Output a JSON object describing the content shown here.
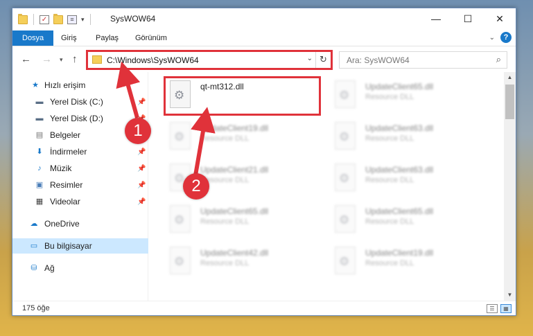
{
  "window": {
    "title": "SysWOW64",
    "controls": {
      "minimize": "—",
      "maximize": "☐",
      "close": "✕"
    }
  },
  "ribbon": {
    "tabs": [
      "Dosya",
      "Giriş",
      "Paylaş",
      "Görünüm"
    ],
    "help": "?"
  },
  "navigation": {
    "address": "C:\\Windows\\SysWOW64",
    "search_placeholder": "Ara: SysWOW64"
  },
  "sidebar": {
    "items": [
      {
        "label": "Hızlı erişim",
        "icon": "star-icon",
        "pinned": false
      },
      {
        "label": "Yerel Disk (C:)",
        "icon": "drive-icon",
        "pinned": true
      },
      {
        "label": "Yerel Disk (D:)",
        "icon": "drive-icon",
        "pinned": true
      },
      {
        "label": "Belgeler",
        "icon": "document-icon",
        "pinned": true
      },
      {
        "label": "İndirmeler",
        "icon": "download-icon",
        "pinned": true
      },
      {
        "label": "Müzik",
        "icon": "music-icon",
        "pinned": true
      },
      {
        "label": "Resimler",
        "icon": "picture-icon",
        "pinned": true
      },
      {
        "label": "Videolar",
        "icon": "video-icon",
        "pinned": true
      },
      {
        "label": "OneDrive",
        "icon": "cloud-icon",
        "pinned": false
      },
      {
        "label": "Bu bilgisayar",
        "icon": "computer-icon",
        "pinned": false,
        "selected": true
      },
      {
        "label": "Ağ",
        "icon": "network-icon",
        "pinned": false
      }
    ]
  },
  "files": [
    {
      "name": "qt-mt312.dll",
      "type": "",
      "highlighted": true
    },
    {
      "name": "UpdateClient65.dll",
      "type": "Resource DLL"
    },
    {
      "name": "UpdateClient19.dll",
      "type": "Resource DLL"
    },
    {
      "name": "UpdateClient63.dll",
      "type": "Resource DLL"
    },
    {
      "name": "UpdateClient21.dll",
      "type": "Resource DLL"
    },
    {
      "name": "UpdateClient63.dll",
      "type": "Resource DLL"
    },
    {
      "name": "UpdateClient65.dll",
      "type": "Resource DLL"
    },
    {
      "name": "UpdateClient65.dll",
      "type": "Resource DLL"
    },
    {
      "name": "UpdateClient42.dll",
      "type": "Resource DLL"
    },
    {
      "name": "UpdateClient19.dll",
      "type": "Resource DLL"
    }
  ],
  "status": {
    "item_count": "175 öğe"
  },
  "annotations": {
    "step1": "1",
    "step2": "2"
  },
  "colors": {
    "accent": "#1979ca",
    "highlight": "#e0323a",
    "selected": "#cce8ff"
  }
}
